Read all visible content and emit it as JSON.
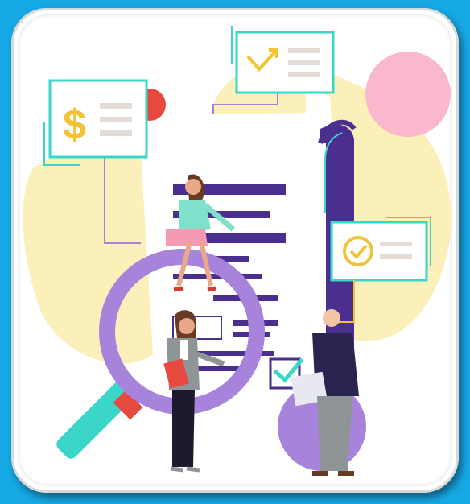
{
  "illustration": {
    "subject": "financial-audit-analysis",
    "icons": [
      "dollar-icon",
      "check-arrow-icon",
      "clock-check-icon",
      "magnifier-icon",
      "checkbox-icon"
    ]
  },
  "colors": {
    "background": "#17a9e6",
    "card": "#ffffff",
    "accent_teal": "#3ad6c9",
    "accent_purple": "#4a2f8f",
    "magnifier_ring": "#a783db",
    "blob_yellow": "#fbf0ba",
    "circle_pink": "#f9b8cc",
    "circle_red": "#e8493f",
    "dollar_yellow": "#f4c234",
    "clock_yellow": "#f0c43a"
  }
}
